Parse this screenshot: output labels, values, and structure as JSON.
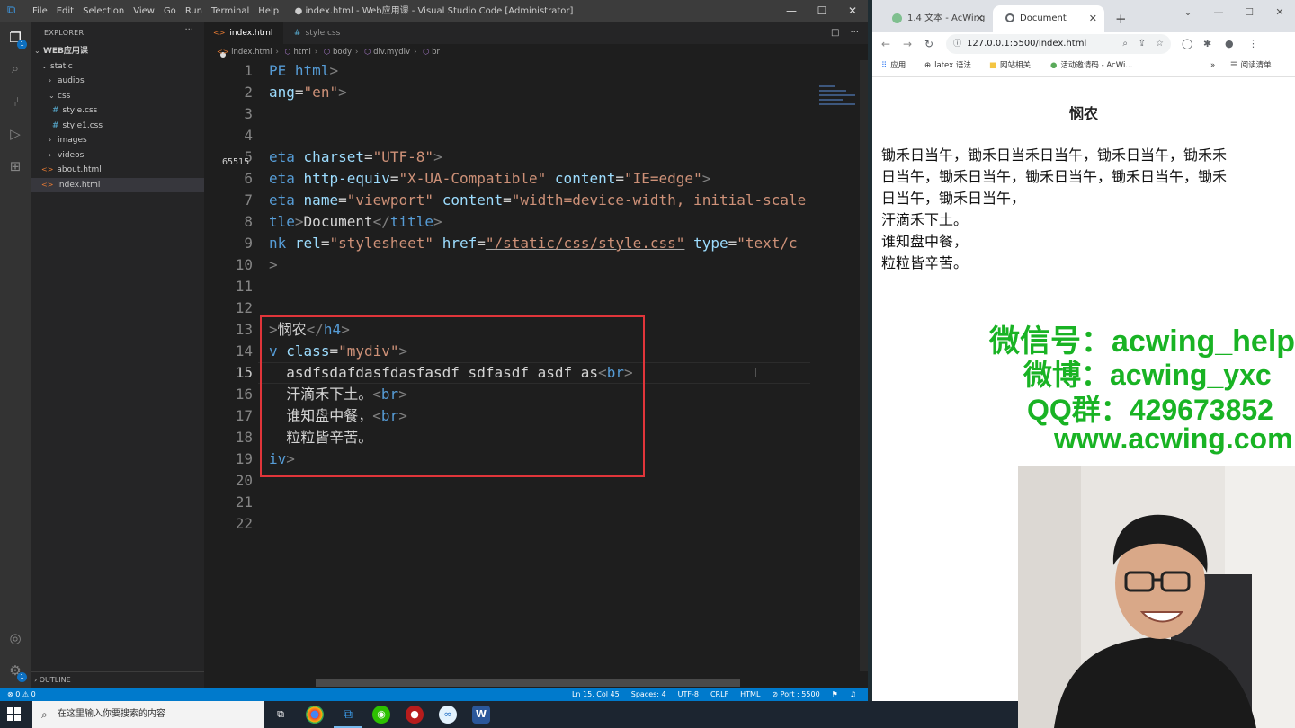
{
  "vscode": {
    "menu": [
      "File",
      "Edit",
      "Selection",
      "View",
      "Go",
      "Run",
      "Terminal",
      "Help"
    ],
    "window_title": "● index.html - Web应用课 - Visual Studio Code [Administrator]",
    "explorer": {
      "header": "EXPLORER",
      "root": "WEB应用课",
      "items": [
        {
          "label": "static",
          "kind": "folder-open"
        },
        {
          "label": "audios",
          "kind": "folder"
        },
        {
          "label": "css",
          "kind": "folder-open"
        },
        {
          "label": "style.css",
          "kind": "css"
        },
        {
          "label": "style1.css",
          "kind": "css"
        },
        {
          "label": "images",
          "kind": "folder"
        },
        {
          "label": "videos",
          "kind": "folder"
        },
        {
          "label": "about.html",
          "kind": "html"
        },
        {
          "label": "index.html",
          "kind": "html"
        }
      ],
      "outline": "OUTLINE"
    },
    "tabs": [
      {
        "label": "index.html",
        "dirty": true
      },
      {
        "label": "style.css",
        "dirty": false
      }
    ],
    "breadcrumb": [
      "index.html",
      "html",
      "body",
      "div.mydiv",
      "br"
    ],
    "line_numbers": [
      "1",
      "2",
      "3",
      "4",
      "5",
      "6",
      "7",
      "8",
      "9",
      "10",
      "11",
      "12",
      "13",
      "14",
      "15",
      "16",
      "17",
      "18",
      "19",
      "20",
      "21",
      "22"
    ],
    "line_hint": "65515",
    "code": {
      "l1a": "PE",
      "l1b": "html",
      "l2a": "ang",
      "l2b": "\"en\"",
      "l5a": "eta",
      "l5b": "charset",
      "l5c": "\"UTF-8\"",
      "l6a": "eta",
      "l6b": "http-equiv",
      "l6c": "\"X-UA-Compatible\"",
      "l6d": "content",
      "l6e": "\"IE=edge\"",
      "l7a": "eta",
      "l7b": "name",
      "l7c": "\"viewport\"",
      "l7d": "content",
      "l7e": "\"width=device-width, initial-scale",
      "l8a": "tle",
      "l8b": "Document",
      "l8c": "title",
      "l9a": "nk",
      "l9b": "rel",
      "l9c": "\"stylesheet\"",
      "l9d": "href",
      "l9e": "\"/static/css/style.css\"",
      "l9f": "type",
      "l9g": "\"text/c",
      "l13a": "悯农",
      "l13b": "h4",
      "l14a": "v",
      "l14b": "class",
      "l14c": "\"mydiv\"",
      "l15a": "asdfsdafdasfdasfasdf sdfasdf asdf as",
      "l15b": "br",
      "l16a": "汗滴禾下土。",
      "l16b": "br",
      "l17a": "谁知盘中餐，",
      "l17b": "br",
      "l18a": "粒粒皆辛苦。",
      "l19a": "iv"
    },
    "status": {
      "problems": "⊗ 0 ⚠ 0",
      "position": "Ln 15, Col 45",
      "spaces": "Spaces: 4",
      "encoding": "UTF-8",
      "eol": "CRLF",
      "language": "HTML",
      "port": "⊘ Port : 5500"
    }
  },
  "chrome": {
    "tabs": [
      {
        "label": "1.4 文本 - AcWing"
      },
      {
        "label": "Document"
      }
    ],
    "url": "127.0.0.1:5500/index.html",
    "bookmarks": [
      "应用",
      "latex 语法",
      "网站相关",
      "活动邀请码 - AcWi...",
      "阅读清单"
    ],
    "page": {
      "heading": "悯农",
      "lines": [
        "锄禾日当午，锄禾日当禾日当午，锄禾日当午，锄禾禾",
        "日当午，锄禾日当午，锄禾日当午，锄禾日当午，锄禾",
        "日当午，锄禾日当午，",
        "汗滴禾下土。",
        "谁知盘中餐，",
        "粒粒皆辛苦。"
      ]
    }
  },
  "overlay": {
    "wechat": "微信号：acwing_helper",
    "weibo": "微博：acwing_yxc",
    "qq": "QQ群：429673852",
    "site": "www.acwing.com"
  },
  "taskbar": {
    "search_placeholder": "在这里输入你要搜索的内容"
  },
  "colors": {
    "accent": "#007acc",
    "highlight_box": "#e0353a",
    "overlay_text": "#19b324"
  }
}
